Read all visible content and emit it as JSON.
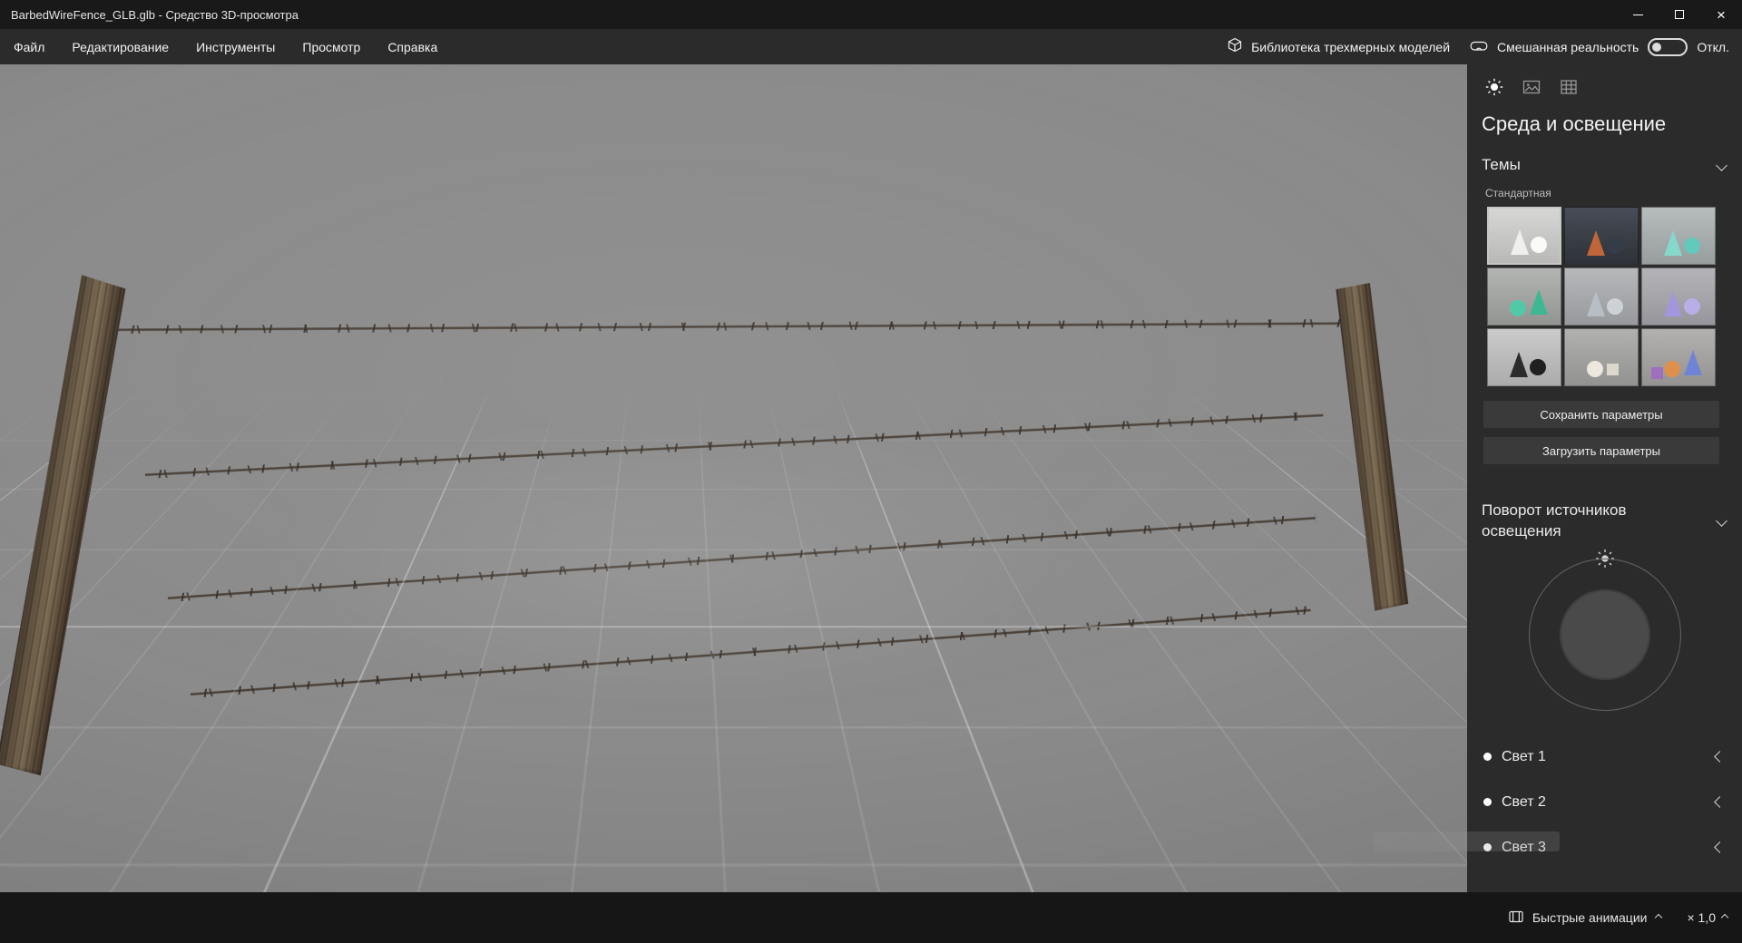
{
  "window": {
    "title": "BarbedWireFence_GLB.glb - Средство 3D-просмотра"
  },
  "menu": {
    "items": [
      "Файл",
      "Редактирование",
      "Инструменты",
      "Просмотр",
      "Справка"
    ],
    "library": "Библиотека трехмерных моделей",
    "mixed_reality": {
      "label": "Смешанная реальность",
      "state": "Откл.",
      "enabled": false
    }
  },
  "panel": {
    "title": "Среда и освещение",
    "themes": {
      "header": "Темы",
      "group": "Стандартная",
      "save_button": "Сохранить параметры",
      "load_button": "Загрузить параметры",
      "items": [
        {
          "selected": true,
          "bg": [
            "#d6d6d4",
            "#b9b9b7"
          ],
          "shapes": [
            {
              "t": "cone",
              "c": "#efefed"
            },
            {
              "t": "sphere",
              "c": "#fafaf8"
            }
          ]
        },
        {
          "selected": false,
          "bg": [
            "#474d56",
            "#2e3238"
          ],
          "shapes": [
            {
              "t": "cone",
              "c": "#c2653a"
            },
            {
              "t": "sphere",
              "c": "#343c48"
            }
          ]
        },
        {
          "selected": false,
          "bg": [
            "#b7bcbc",
            "#989e9e"
          ],
          "shapes": [
            {
              "t": "cone",
              "c": "#84d8cc"
            },
            {
              "t": "sphere",
              "c": "#63c9bc"
            }
          ]
        },
        {
          "selected": false,
          "bg": [
            "#b2b4b2",
            "#939593"
          ],
          "shapes": [
            {
              "t": "sphere",
              "c": "#52c9a6"
            },
            {
              "t": "cone",
              "c": "#3eb892"
            }
          ]
        },
        {
          "selected": false,
          "bg": [
            "#b6b8ba",
            "#97999d"
          ],
          "shapes": [
            {
              "t": "cone",
              "c": "#b7bec4"
            },
            {
              "t": "sphere",
              "c": "#ccd2d6"
            }
          ]
        },
        {
          "selected": false,
          "bg": [
            "#b4b4b8",
            "#96969c"
          ],
          "shapes": [
            {
              "t": "cone",
              "c": "#a396dc"
            },
            {
              "t": "sphere",
              "c": "#b9aee8"
            }
          ]
        },
        {
          "selected": false,
          "bg": [
            "#cbcbcb",
            "#ababab"
          ],
          "shapes": [
            {
              "t": "cone",
              "c": "#2c2c2c"
            },
            {
              "t": "sphere",
              "c": "#202020"
            }
          ]
        },
        {
          "selected": false,
          "bg": [
            "#b1b1af",
            "#929290"
          ],
          "shapes": [
            {
              "t": "sphere",
              "c": "#ece8de"
            },
            {
              "t": "cube",
              "c": "#dcd8cc"
            }
          ]
        },
        {
          "selected": false,
          "bg": [
            "#b3b1af",
            "#959391"
          ],
          "shapes": [
            {
              "t": "sphere",
              "c": "#dd8f4c"
            },
            {
              "t": "cone",
              "c": "#6f83d6"
            },
            {
              "t": "cube",
              "c": "#9e6fbc"
            }
          ]
        }
      ]
    },
    "rotation_header": "Поворот источников освещения",
    "lights": [
      {
        "label": "Свет 1",
        "on": true
      },
      {
        "label": "Свет 2",
        "on": true
      },
      {
        "label": "Свет 3",
        "on": true
      }
    ]
  },
  "playback": {
    "fast_animations": "Быстрые анимации",
    "speed": "× 1,0"
  },
  "colors": {
    "titlebar_bg": "#191919",
    "menubar_bg": "#2b2b2b",
    "panel_bg": "#2b2b2b",
    "viewport_bg": "#8b8b8b",
    "bottombar_bg": "#161616",
    "active_icon": "#ffffff"
  }
}
